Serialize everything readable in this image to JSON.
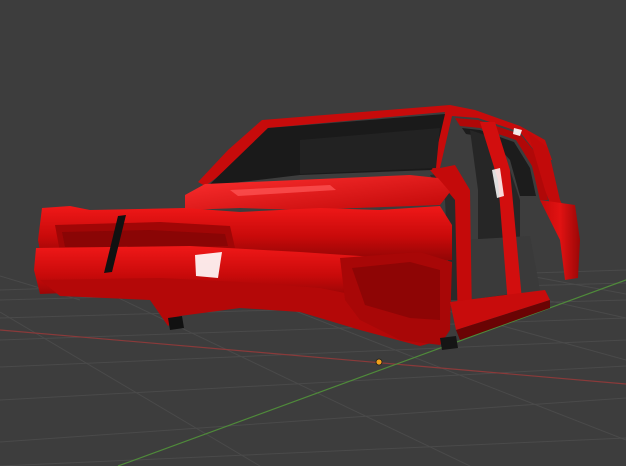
{
  "viewport": {
    "background": "#3d3d3d",
    "grid_color": "#4a4a4a",
    "x_axis_color": "#8a3a3a",
    "y_axis_color": "#4f8a3a",
    "origin_color": "#f2a21a"
  },
  "model": {
    "body_color": "#d00d0d",
    "shadow_color": "#8a0606",
    "highlight_color": "#ff5a5a",
    "interior_color": "#1e1e1e",
    "glass_dark": "#151515",
    "accent_icon": "vehicle-body-mesh-icon"
  }
}
